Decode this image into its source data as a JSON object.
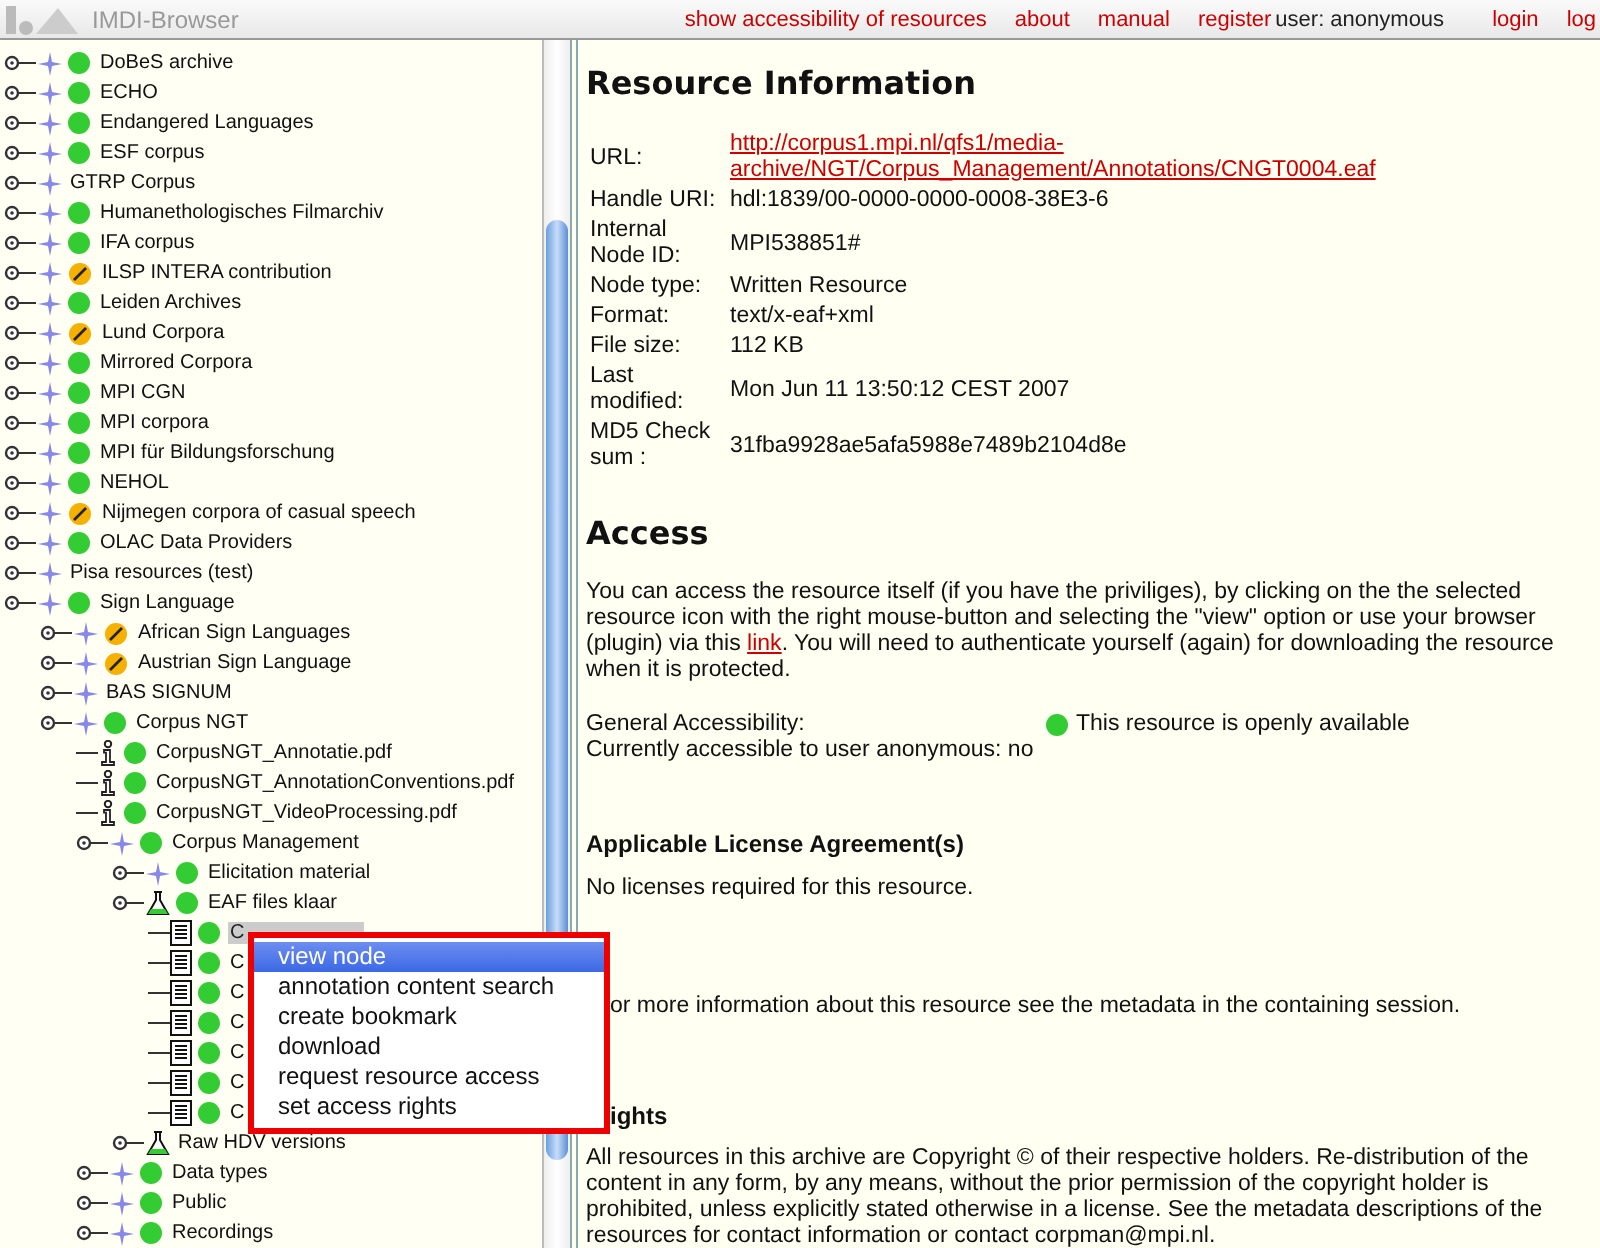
{
  "app_title": "IMDI-Browser",
  "top_links": [
    {
      "kind": "link",
      "text": "show accessibility of resources"
    },
    {
      "kind": "link",
      "text": "about"
    },
    {
      "kind": "link",
      "text": "manual"
    },
    {
      "kind": "link",
      "text": "register"
    },
    {
      "kind": "text",
      "text": "user: anonymous"
    },
    {
      "kind": "link",
      "text": "login"
    },
    {
      "kind": "link",
      "text": "log"
    }
  ],
  "tree": [
    {
      "label": "DoBeS archive",
      "kind": "collection",
      "color": "#33cc33",
      "slashed": false
    },
    {
      "label": "ECHO",
      "kind": "collection",
      "color": "#33cc33",
      "slashed": false
    },
    {
      "label": "Endangered Languages",
      "kind": "collection",
      "color": "#33cc33",
      "slashed": false
    },
    {
      "label": "ESF corpus",
      "kind": "collection",
      "color": "#33cc33",
      "slashed": false
    },
    {
      "label": "GTRP Corpus",
      "kind": "collection"
    },
    {
      "label": "Humanethologisches Filmarchiv",
      "kind": "collection",
      "color": "#33cc33",
      "slashed": false
    },
    {
      "label": "IFA corpus",
      "kind": "collection",
      "color": "#33cc33",
      "slashed": false
    },
    {
      "label": "ILSP INTERA contribution",
      "kind": "collection",
      "color": "#f5b000",
      "slashed": true
    },
    {
      "label": "Leiden Archives",
      "kind": "collection",
      "color": "#33cc33",
      "slashed": false
    },
    {
      "label": "Lund Corpora",
      "kind": "collection",
      "color": "#f5b000",
      "slashed": true
    },
    {
      "label": "Mirrored Corpora",
      "kind": "collection",
      "color": "#33cc33",
      "slashed": false
    },
    {
      "label": "MPI CGN",
      "kind": "collection",
      "color": "#33cc33",
      "slashed": false
    },
    {
      "label": "MPI corpora",
      "kind": "collection",
      "color": "#33cc33",
      "slashed": false
    },
    {
      "label": "MPI für Bildungsforschung",
      "kind": "collection",
      "color": "#33cc33",
      "slashed": false
    },
    {
      "label": "NEHOL",
      "kind": "collection",
      "color": "#33cc33",
      "slashed": false
    },
    {
      "label": "Nijmegen corpora of casual speech",
      "kind": "collection",
      "color": "#f5b000",
      "slashed": true
    },
    {
      "label": "OLAC Data Providers",
      "kind": "collection",
      "color": "#33cc33",
      "slashed": false
    },
    {
      "label": "Pisa resources (test)",
      "kind": "collection"
    },
    {
      "label": "Sign Language",
      "kind": "collection",
      "color": "#33cc33",
      "slashed": false,
      "children": [
        {
          "label": "African Sign Languages",
          "kind": "collection",
          "color": "#f5b000",
          "slashed": true
        },
        {
          "label": "Austrian Sign Language",
          "kind": "collection",
          "color": "#f5b000",
          "slashed": true
        },
        {
          "label": "BAS SIGNUM",
          "kind": "collection"
        },
        {
          "label": "Corpus NGT",
          "kind": "collection",
          "color": "#33cc33",
          "slashed": false,
          "children": [
            {
              "label": "CorpusNGT_Annotatie.pdf",
              "kind": "pdf",
              "color": "#33cc33",
              "slashed": false
            },
            {
              "label": "CorpusNGT_AnnotationConventions.pdf",
              "kind": "pdf",
              "color": "#33cc33",
              "slashed": false
            },
            {
              "label": "CorpusNGT_VideoProcessing.pdf",
              "kind": "pdf",
              "color": "#33cc33",
              "slashed": false
            },
            {
              "label": "Corpus Management",
              "kind": "collection",
              "color": "#33cc33",
              "slashed": false,
              "children": [
                {
                  "label": "Elicitation material",
                  "kind": "collection",
                  "color": "#33cc33",
                  "slashed": false
                },
                {
                  "label": "EAF files klaar",
                  "kind": "session",
                  "color": "#33cc33",
                  "slashed": false,
                  "children": [
                    {
                      "label": "C",
                      "kind": "eaf",
                      "color": "#33cc33",
                      "slashed": false,
                      "selected": true
                    },
                    {
                      "label": "C",
                      "kind": "eaf",
                      "color": "#33cc33",
                      "slashed": false,
                      "selected": false
                    },
                    {
                      "label": "C",
                      "kind": "eaf",
                      "color": "#33cc33",
                      "slashed": false,
                      "selected": false
                    },
                    {
                      "label": "C",
                      "kind": "eaf",
                      "color": "#33cc33",
                      "slashed": false,
                      "selected": false
                    },
                    {
                      "label": "C",
                      "kind": "eaf",
                      "color": "#33cc33",
                      "slashed": false,
                      "selected": false
                    },
                    {
                      "label": "C",
                      "kind": "eaf",
                      "color": "#33cc33",
                      "slashed": false,
                      "selected": false
                    },
                    {
                      "label": "C",
                      "kind": "eaf",
                      "color": "#33cc33",
                      "slashed": false,
                      "selected": false
                    }
                  ]
                },
                {
                  "label": "Raw HDV versions",
                  "kind": "session"
                }
              ]
            },
            {
              "label": "Data types",
              "kind": "collection",
              "color": "#33cc33",
              "slashed": false
            },
            {
              "label": "Public",
              "kind": "collection",
              "color": "#33cc33",
              "slashed": false
            },
            {
              "label": "Recordings",
              "kind": "collection",
              "color": "#33cc33",
              "slashed": false
            }
          ]
        }
      ]
    }
  ],
  "context_menu": [
    {
      "label": "view node",
      "selected": true
    },
    {
      "label": "annotation content search",
      "selected": false
    },
    {
      "label": "create bookmark",
      "selected": false
    },
    {
      "label": "download",
      "selected": false
    },
    {
      "label": "request resource access",
      "selected": false
    },
    {
      "label": "set access rights",
      "selected": false
    }
  ],
  "resource_info": {
    "title": "Resource Information",
    "fields": [
      {
        "label": "URL:",
        "value": "http://corpus1.mpi.nl/qfs1/media-archive/NGT/Corpus_Management/Annotations/CNGT0004.eaf",
        "kind": "link"
      },
      {
        "label": "Handle URI:",
        "value": "hdl:1839/00-0000-0000-0008-38E3-6",
        "kind": "text"
      },
      {
        "label": "Internal Node ID:",
        "value": "MPI538851#",
        "kind": "text"
      },
      {
        "label": "Node type:",
        "value": "Written Resource",
        "kind": "text"
      },
      {
        "label": "Format:",
        "value": "text/x-eaf+xml",
        "kind": "text"
      },
      {
        "label": "File size:",
        "value": "112 KB",
        "kind": "text"
      },
      {
        "label": "Last modified:",
        "value": "Mon Jun 11 13:50:12 CEST 2007",
        "kind": "text"
      },
      {
        "label": "MD5 Check sum :",
        "value": "31fba9928ae5afa5988e7489b2104d8e",
        "kind": "text"
      }
    ]
  },
  "access": {
    "title": "Access",
    "text_before": "You can access the resource itself (if you have the priviliges), by clicking on the the selected resource icon with the right mouse-button and selecting the \"view\" option or use your browser (plugin) via this ",
    "link": "link",
    "text_after": ". You will need to authenticate yourself (again) for downloading the resource when it is protected.",
    "general_label": "General Accessibility:",
    "general_open": true,
    "general_text": "This resource is openly available",
    "current": "Currently accessible to user anonymous: no"
  },
  "license": {
    "title": "Applicable License Agreement(s)",
    "text": "No licenses required for this resource."
  },
  "more_info": "or more information about this resource see the metadata in the containing session.",
  "rights": {
    "title": "ights",
    "text": "All resources in this archive are Copyright © of their respective holders. Re-distribution of the content in any form, by any means, without the prior permission of the copyright holder is prohibited, unless explicitly stated otherwise in a license. See the metadata descriptions of the resources for contact information or contact corpman@mpi.nl."
  }
}
